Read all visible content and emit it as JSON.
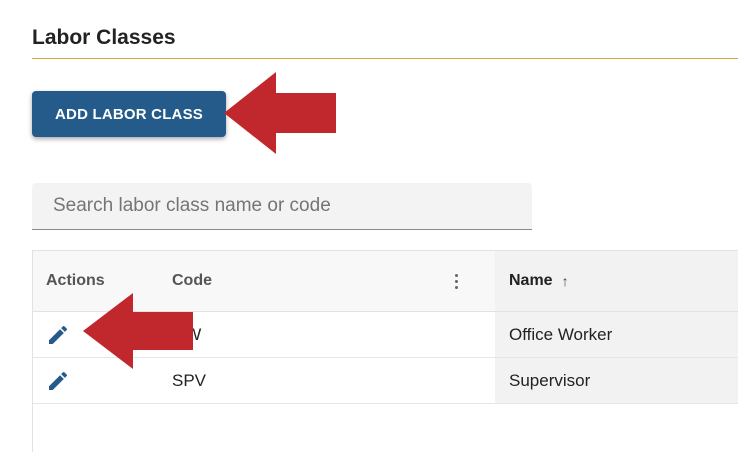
{
  "section": {
    "title": "Labor Classes"
  },
  "add_button": {
    "label": "ADD LABOR CLASS"
  },
  "search": {
    "placeholder": "Search labor class name or code",
    "value": ""
  },
  "table": {
    "columns": {
      "actions": "Actions",
      "code": "Code",
      "name": "Name",
      "name_sort_indicator": "↑"
    },
    "rows": [
      {
        "code": "OW",
        "name": "Office Worker"
      },
      {
        "code": "SPV",
        "name": "Supervisor"
      }
    ]
  },
  "icons": {
    "edit": "pencil-icon",
    "column_menu": "more-vert-icon",
    "annotation_arrow": "red-arrow"
  },
  "colors": {
    "accent_rule": "#d9a441",
    "primary_button": "#255b8a",
    "edit_icon": "#255b8a",
    "annotation_arrow": "#c0282d"
  }
}
